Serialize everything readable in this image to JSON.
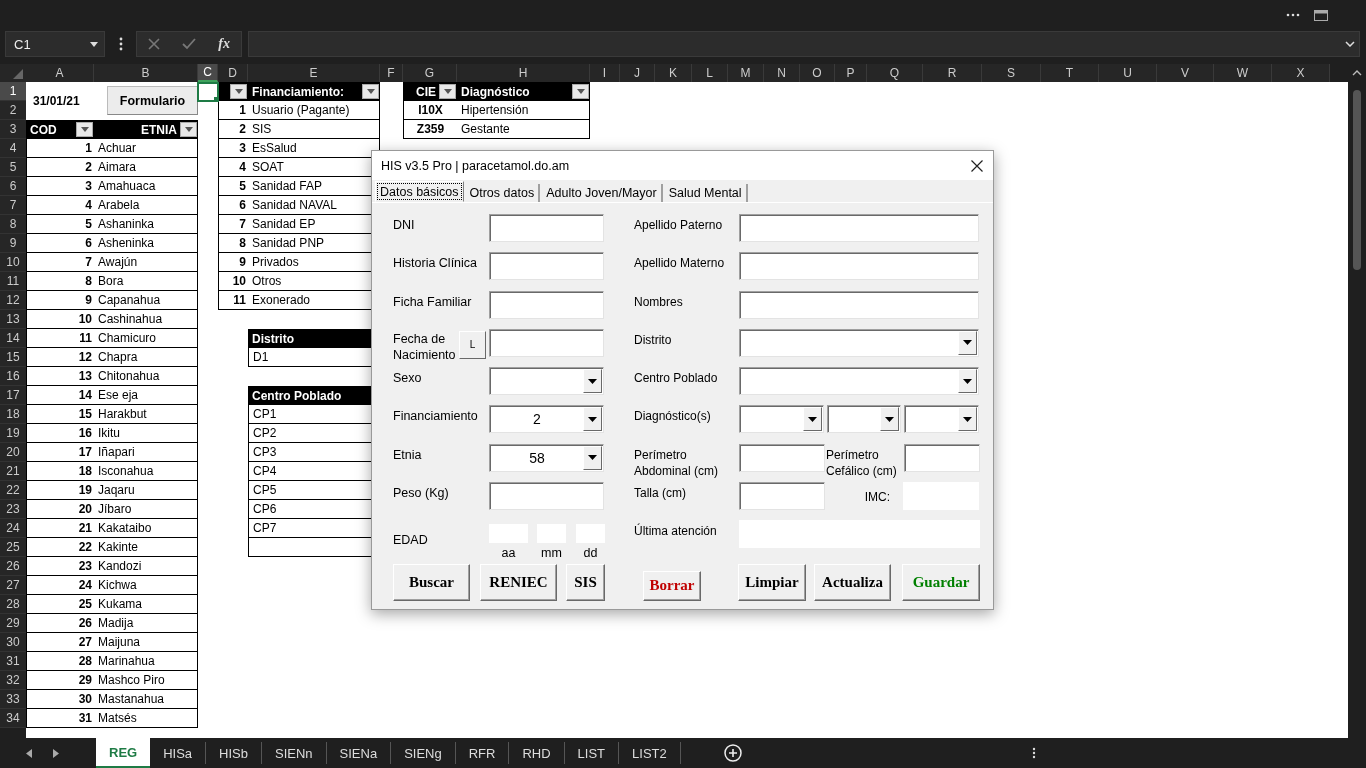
{
  "formula_bar": {
    "name_box": "C1",
    "function_label": "fx"
  },
  "columns": [
    {
      "label": "A",
      "selected": false
    },
    {
      "label": "B",
      "selected": false
    },
    {
      "label": "C",
      "selected": true
    },
    {
      "label": "D",
      "selected": false
    },
    {
      "label": "E",
      "selected": false
    },
    {
      "label": "F",
      "selected": false
    },
    {
      "label": "G",
      "selected": false
    },
    {
      "label": "H",
      "selected": false
    },
    {
      "label": "I",
      "selected": false
    },
    {
      "label": "J",
      "selected": false
    },
    {
      "label": "K",
      "selected": false
    },
    {
      "label": "L",
      "selected": false
    },
    {
      "label": "M",
      "selected": false
    },
    {
      "label": "N",
      "selected": false
    },
    {
      "label": "O",
      "selected": false
    },
    {
      "label": "P",
      "selected": false
    },
    {
      "label": "Q",
      "selected": false
    },
    {
      "label": "R",
      "selected": false
    },
    {
      "label": "S",
      "selected": false
    },
    {
      "label": "T",
      "selected": false
    },
    {
      "label": "U",
      "selected": false
    },
    {
      "label": "V",
      "selected": false
    },
    {
      "label": "W",
      "selected": false
    },
    {
      "label": "X",
      "selected": false
    }
  ],
  "rows": [
    {
      "label": "1",
      "selected": true
    },
    {
      "label": "2",
      "selected": false
    },
    {
      "label": "3",
      "selected": false
    },
    {
      "label": "4",
      "selected": false
    },
    {
      "label": "5",
      "selected": false
    },
    {
      "label": "6",
      "selected": false
    },
    {
      "label": "7",
      "selected": false
    },
    {
      "label": "8",
      "selected": false
    },
    {
      "label": "9",
      "selected": false
    },
    {
      "label": "10",
      "selected": false
    },
    {
      "label": "11",
      "selected": false
    },
    {
      "label": "12",
      "selected": false
    },
    {
      "label": "13",
      "selected": false
    },
    {
      "label": "14",
      "selected": false
    },
    {
      "label": "15",
      "selected": false
    },
    {
      "label": "16",
      "selected": false
    },
    {
      "label": "17",
      "selected": false
    },
    {
      "label": "18",
      "selected": false
    },
    {
      "label": "19",
      "selected": false
    },
    {
      "label": "20",
      "selected": false
    },
    {
      "label": "21",
      "selected": false
    },
    {
      "label": "22",
      "selected": false
    },
    {
      "label": "23",
      "selected": false
    },
    {
      "label": "24",
      "selected": false
    },
    {
      "label": "25",
      "selected": false
    },
    {
      "label": "26",
      "selected": false
    },
    {
      "label": "27",
      "selected": false
    },
    {
      "label": "28",
      "selected": false
    },
    {
      "label": "29",
      "selected": false
    },
    {
      "label": "30",
      "selected": false
    },
    {
      "label": "31",
      "selected": false
    },
    {
      "label": "32",
      "selected": false
    },
    {
      "label": "33",
      "selected": false
    },
    {
      "label": "34",
      "selected": false
    }
  ],
  "sheet": {
    "date": "31/01/21",
    "form_button": "Formulario",
    "etnia_table": {
      "columns": [
        "COD",
        "ETNIA"
      ],
      "rows": [
        [
          "1",
          "Achuar"
        ],
        [
          "2",
          "Aimara"
        ],
        [
          "3",
          "Amahuaca"
        ],
        [
          "4",
          "Arabela"
        ],
        [
          "5",
          "Ashaninka"
        ],
        [
          "6",
          "Asheninka"
        ],
        [
          "7",
          "Awajún"
        ],
        [
          "8",
          "Bora"
        ],
        [
          "9",
          "Capanahua"
        ],
        [
          "10",
          "Cashinahua"
        ],
        [
          "11",
          "Chamicuro"
        ],
        [
          "12",
          "Chapra"
        ],
        [
          "13",
          "Chitonahua"
        ],
        [
          "14",
          "Ese eja"
        ],
        [
          "15",
          "Harakbut"
        ],
        [
          "16",
          "Ikitu"
        ],
        [
          "17",
          "Iñapari"
        ],
        [
          "18",
          "Isconahua"
        ],
        [
          "19",
          "Jaqaru"
        ],
        [
          "20",
          "Jíbaro"
        ],
        [
          "21",
          "Kakataibo"
        ],
        [
          "22",
          "Kakinte"
        ],
        [
          "23",
          "Kandozi"
        ],
        [
          "24",
          "Kichwa"
        ],
        [
          "25",
          "Kukama"
        ],
        [
          "26",
          "Madija"
        ],
        [
          "27",
          "Maijuna"
        ],
        [
          "28",
          "Marinahua"
        ],
        [
          "29",
          "Mashco Piro"
        ],
        [
          "30",
          "Mastanahua"
        ],
        [
          "31",
          "Matsés"
        ]
      ]
    },
    "financiamiento_table": {
      "columns": [
        "",
        "Financiamiento:"
      ],
      "rows": [
        [
          "1",
          "Usuario (Pagante)"
        ],
        [
          "2",
          "SIS"
        ],
        [
          "3",
          "EsSalud"
        ],
        [
          "4",
          "SOAT"
        ],
        [
          "5",
          "Sanidad FAP"
        ],
        [
          "6",
          "Sanidad NAVAL"
        ],
        [
          "7",
          "Sanidad EP"
        ],
        [
          "8",
          "Sanidad PNP"
        ],
        [
          "9",
          "Privados"
        ],
        [
          "10",
          "Otros"
        ],
        [
          "11",
          "Exonerado"
        ]
      ]
    },
    "diagnostico_table": {
      "columns": [
        "CIE",
        "Diagnóstico"
      ],
      "rows": [
        {
          "code": "I10X",
          "name": "Hipertensión"
        },
        {
          "code": "Z359",
          "name": "Gestante"
        }
      ]
    },
    "distrito_table": {
      "columns": [
        "Distrito"
      ],
      "rows": [
        "D1"
      ]
    },
    "centro_poblado_table": {
      "columns": [
        "Centro Poblado"
      ],
      "rows": [
        "CP1",
        "CP2",
        "CP3",
        "CP4",
        "CP5",
        "CP6",
        "CP7"
      ]
    }
  },
  "dialog": {
    "title": "HIS v3.5 Pro | paracetamol.do.am",
    "tabs": [
      {
        "label": "Datos básicos",
        "selected": true
      },
      {
        "label": "Otros datos",
        "selected": false
      },
      {
        "label": "Adulto Joven/Mayor",
        "selected": false
      },
      {
        "label": "Salud Mental",
        "selected": false
      }
    ],
    "left_fields": [
      {
        "label": "DNI",
        "kind": "text"
      },
      {
        "label": "Historia Clínica",
        "kind": "text"
      },
      {
        "label": "Ficha Familiar",
        "kind": "text"
      },
      {
        "label": "Fecha de Nacimiento",
        "kind": "date",
        "button": "L"
      },
      {
        "label": "Sexo",
        "kind": "combo"
      },
      {
        "label": "Financiamiento",
        "kind": "combo",
        "value": "2"
      },
      {
        "label": "Etnia",
        "kind": "combo",
        "value": "58"
      },
      {
        "label": "Peso (Kg)",
        "kind": "text"
      },
      {
        "label": "EDAD",
        "kind": "age",
        "parts": [
          "aa",
          "mm",
          "dd"
        ]
      }
    ],
    "right_fields": [
      {
        "label": "Apellido Paterno",
        "kind": "text"
      },
      {
        "label": "Apellido Materno",
        "kind": "text"
      },
      {
        "label": "Nombres",
        "kind": "text"
      },
      {
        "label": "Distrito",
        "kind": "combo"
      },
      {
        "label": "Centro Poblado",
        "kind": "combo"
      },
      {
        "label": "Diagnóstico(s)",
        "kind": "multi_combo"
      },
      {
        "label": "Perímetro Abdominal (cm)",
        "kind": "pair",
        "second_label": "Perímetro Cefálico (cm)"
      },
      {
        "label": "Talla (cm)",
        "kind": "pair_flat",
        "second_label": "IMC:"
      },
      {
        "label": "Última atención",
        "kind": "flat"
      }
    ],
    "left_buttons": [
      {
        "label": "Buscar",
        "color": "#000000"
      },
      {
        "label": "RENIEC",
        "color": "#000000"
      },
      {
        "label": "SIS",
        "color": "#000000"
      }
    ],
    "right_buttons": [
      {
        "label": "Borrar",
        "color": "#c00000",
        "kind": "small"
      },
      {
        "label": "Limpiar",
        "color": "#000000",
        "kind": "large"
      },
      {
        "label": "Actualiza",
        "color": "#000000",
        "kind": "large"
      },
      {
        "label": "Guardar",
        "color": "#008000",
        "kind": "large"
      }
    ]
  },
  "sheet_tabs": [
    {
      "label": "REG",
      "selected": true
    },
    {
      "label": "HISa",
      "selected": false
    },
    {
      "label": "HISb",
      "selected": false
    },
    {
      "label": "SIENn",
      "selected": false
    },
    {
      "label": "SIENa",
      "selected": false
    },
    {
      "label": "SIENg",
      "selected": false
    },
    {
      "label": "RFR",
      "selected": false
    },
    {
      "label": "RHD",
      "selected": false
    },
    {
      "label": "LIST",
      "selected": false
    },
    {
      "label": "LIST2",
      "selected": false
    }
  ]
}
